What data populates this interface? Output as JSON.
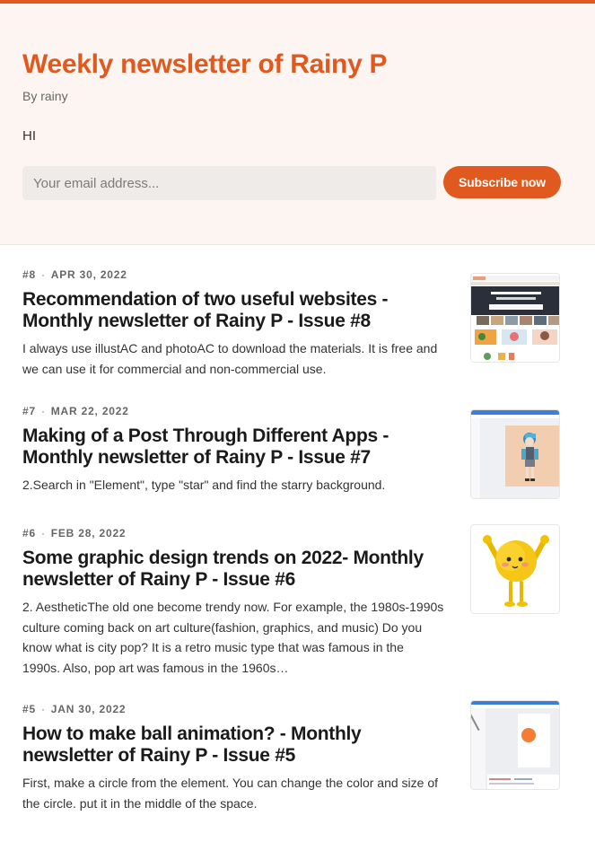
{
  "header": {
    "title": "Weekly newsletter of Rainy P",
    "byline": "By rainy",
    "greeting": "HI",
    "email_placeholder": "Your email address...",
    "subscribe_label": "Subscribe now"
  },
  "posts": [
    {
      "number": "#8",
      "date": "APR 30, 2022",
      "title": "Recommendation of two useful websites - Monthly newsletter of Rainy P - Issue #8",
      "excerpt": "I always use illustAC and photoAC to download the materials. It is free and we can use it for commercial and non-commercial use.",
      "thumbnail": "website-screenshot-thumbnail"
    },
    {
      "number": "#7",
      "date": "MAR 22, 2022",
      "title": "Making of a Post Through Different Apps - Monthly newsletter of Rainy P - Issue #7",
      "excerpt": "2.Search in \"Element\", type \"star\" and find the starry background.",
      "thumbnail": "editor-anime-character-thumbnail"
    },
    {
      "number": "#6",
      "date": "FEB 28, 2022",
      "title": "Some graphic design trends on 2022- Monthly newsletter of Rainy P - Issue #6",
      "excerpt": "2. AestheticThe old one become trendy now. For example, the 1980s-1990s culture coming back on art culture(fashion, graphics, and music) Do you know what is city pop? It is a retro music type that was famous in the 1990s. Also, pop art was famous in the 1960s…",
      "thumbnail": "yellow-3d-character-thumbnail"
    },
    {
      "number": "#5",
      "date": "JAN 30, 2022",
      "title": "How to make ball animation? - Monthly newsletter of Rainy P - Issue #5",
      "excerpt": "First, make a circle from the element. You can change the color and size of the circle. put it in the middle of the space.",
      "thumbnail": "editor-orange-ball-thumbnail"
    }
  ],
  "colors": {
    "accent": "#e05a1f",
    "header_bg": "#fdf5f1"
  }
}
